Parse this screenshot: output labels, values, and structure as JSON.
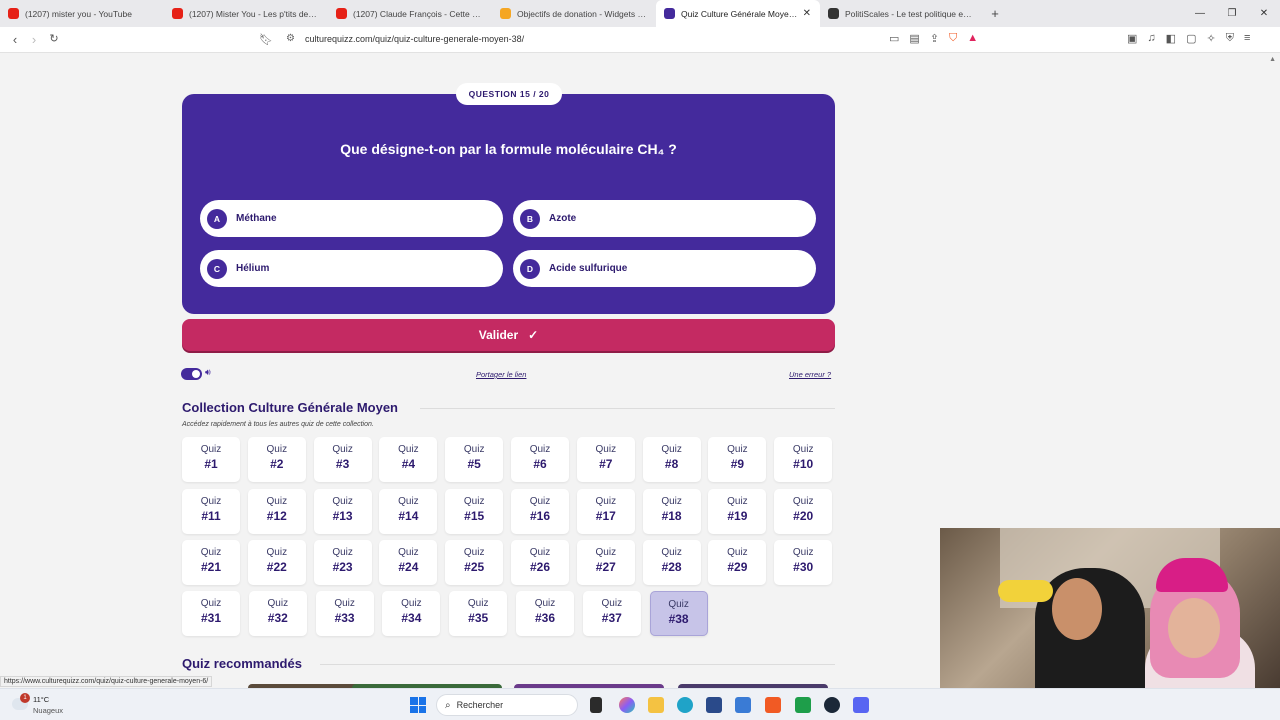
{
  "browser": {
    "tabs": [
      {
        "title": "(1207) mister you - YouTube",
        "icon": "youtube-icon",
        "color": "#e62117",
        "active": false
      },
      {
        "title": "(1207) Mister You - Les p'tits de chez",
        "icon": "youtube-icon",
        "color": "#e62117",
        "active": false
      },
      {
        "title": "(1207) Claude François - Cette année",
        "icon": "youtube-icon",
        "color": "#e62117",
        "active": false
      },
      {
        "title": "Objectifs de donation - Widgets - Dc",
        "icon": "donation-icon",
        "color": "#f5a623",
        "active": false
      },
      {
        "title": "Quiz Culture Générale Moyen #3",
        "icon": "culturequizz-icon",
        "color": "#442a9c",
        "active": true
      },
      {
        "title": "PolitiScales - Le test politique en ligne",
        "icon": "politiscales-icon",
        "color": "#333333",
        "active": false
      }
    ],
    "new_tab": "+",
    "url": "culturequizz.com/quiz/quiz-culture-generale-moyen-38/",
    "status_url": "https://www.culturequizz.com/quiz/quiz-culture-generale-moyen-6/"
  },
  "question": {
    "counter": "QUESTION 15 / 20",
    "text": "Que désigne-t-on par la formule moléculaire CH₄ ?",
    "answers": [
      {
        "letter": "A",
        "text": "Méthane"
      },
      {
        "letter": "B",
        "text": "Azote"
      },
      {
        "letter": "C",
        "text": "Hélium"
      },
      {
        "letter": "D",
        "text": "Acide sulfurique"
      }
    ],
    "validate_label": "Valider",
    "validate_icon": "✓"
  },
  "controls": {
    "share_label": "Portager le lien",
    "error_label": "Une erreur ?",
    "sound_on": true
  },
  "collection": {
    "title": "Collection Culture Générale Moyen",
    "subtitle": "Accédez rapidement à tous les autres quiz de cette collection.",
    "quiz_label": "Quiz",
    "current": 38,
    "numbers": [
      "#1",
      "#2",
      "#3",
      "#4",
      "#5",
      "#6",
      "#7",
      "#8",
      "#9",
      "#10",
      "#11",
      "#12",
      "#13",
      "#14",
      "#15",
      "#16",
      "#17",
      "#18",
      "#19",
      "#20",
      "#21",
      "#22",
      "#23",
      "#24",
      "#25",
      "#26",
      "#27",
      "#28",
      "#29",
      "#30",
      "#31",
      "#32",
      "#33",
      "#34",
      "#35",
      "#36",
      "#37",
      "#38"
    ]
  },
  "recommended": {
    "title": "Quiz recommandés"
  },
  "taskbar": {
    "weather_temp": "11°C",
    "weather_desc": "Nuageux",
    "weather_badge": "1",
    "search_placeholder": "Rechercher"
  },
  "colors": {
    "primary": "#442a9c",
    "accent": "#c42a62",
    "title": "#2d1a6e"
  }
}
